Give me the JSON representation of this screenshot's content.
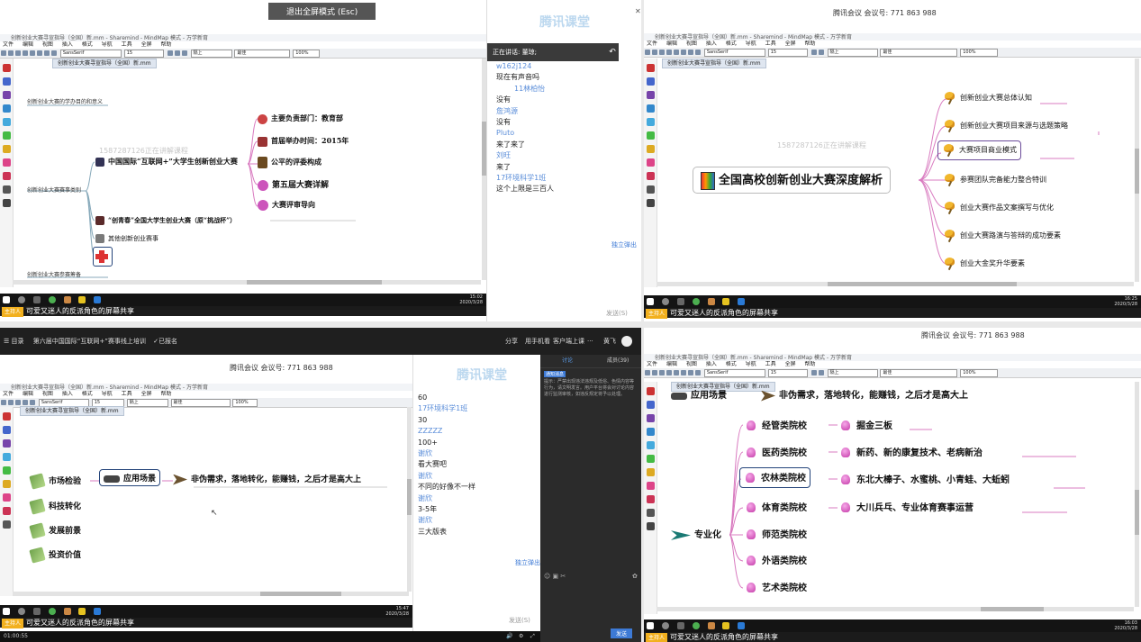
{
  "colors": {
    "accent_blue": "#3d7ad6",
    "chat_name": "#5a8dd9",
    "selection_border": "#24447a",
    "host_badge": "#f2b01e",
    "taskbar": "#141414",
    "link_curve": "#d97bc0"
  },
  "q1": {
    "exit_fullscreen": "退出全屏模式 (Esc)",
    "window_title": "创新创业大赛寻宣指导（全国）新.mm - Sharemind - MindMap 模式 - 万学新育",
    "menu": [
      "文件",
      "编辑",
      "视图",
      "插入",
      "格式",
      "导航",
      "工具",
      "全屏",
      "帮助"
    ],
    "font_select": "SansSerif",
    "size_select": "15",
    "style_select": "隔上",
    "style2_select": "最佳",
    "zoom_select": "100%",
    "doc_tab": "创新创业大赛寻宣指导（全国）新.mm",
    "left_nodes": [
      "创新创业大赛的学办目的和意义",
      "创新创业大赛赛事类别",
      "创新创业大赛参赛筹备"
    ],
    "main_node": "中国国际“互联网+”大学生创新创业大赛",
    "child_nodes": [
      "主要负责部门：教育部",
      "首届举办时间：2015年",
      "公平的评委构成",
      "第五届大赛详解",
      "大赛评审导向"
    ],
    "node_qcz": "“创青春”全国大学生创业大赛（原“挑战杯”）",
    "node_other": "其他创新创业赛事",
    "watermark": "1587287126正在讲解课程",
    "taskbar_time": "15:02",
    "taskbar_date": "2020/3/28",
    "host_label": "主持人",
    "share_text": "可爱又迷人的反派角色的屏幕共享",
    "logo": "腾讯课堂",
    "speaking_label": "正在讲话: 董琼;",
    "chat": [
      {
        "name": "11林柏怡",
        "msg": ""
      },
      {
        "name": "w162j124",
        "msg": "现在有声音吗"
      },
      {
        "name": "11林柏怡",
        "msg": "没有"
      },
      {
        "name": "詹鸿源",
        "msg": "没有"
      },
      {
        "name": "Pluto",
        "msg": "来了来了"
      },
      {
        "name": "刘旺",
        "msg": "来了"
      },
      {
        "name": "17环境科学1班",
        "msg": "这个上限是三百人"
      }
    ],
    "popout": "独立弹出",
    "send": "发送(S)"
  },
  "q2": {
    "meeting_id": "腾讯会议 会议号: 771 863 988",
    "window_title": "创新创业大赛寻宣指导（全国）新.mm - Sharemind - MindMap 模式 - 万学新育",
    "doc_tab": "创新创业大赛寻宣指导（全国）新.mm",
    "root": "全国高校创新创业大赛深度解析",
    "branches": [
      "创新创业大赛总体认知",
      "创新创业大赛项目来源与选题策略",
      "大赛项目商业模式",
      "参赛团队完备能力整合特训",
      "创业大赛作品文案撰写与优化",
      "创业大赛路演与答辩的成功要素",
      "创业大金奖升华要素"
    ],
    "watermark": "1587287126正在讲解课程",
    "taskbar_time": "16:25",
    "taskbar_date": "2020/3/28",
    "host_label": "主持人",
    "share_text": "可爱又迷人的反派角色的屏幕共享"
  },
  "q3": {
    "toc": "目录",
    "course_title": "第六届中国国际“互联网+”赛事线上培训",
    "signed_up": "已报名",
    "share": "分享",
    "phone_watch": "用手机看",
    "client_class": "客户端上课",
    "more": "···",
    "user": "黄飞",
    "meeting_id": "腾讯会议 会议号: 771 863 988",
    "nodes_left": [
      "市场检验",
      "科技转化",
      "发展前景",
      "投资价值"
    ],
    "node_selected": "应用场景",
    "node_right": "非伪需求，落地转化，能赚钱，之后才是高大上",
    "chat": [
      {
        "name": "17环境科学1班",
        "msg": "60"
      },
      {
        "name": "17环境科学1班",
        "msg": "30"
      },
      {
        "name": "ZZZZZ",
        "msg": "100+"
      },
      {
        "name": "谢欣",
        "msg": "看大赛吧"
      },
      {
        "name": "谢欣",
        "msg": "不同的好像不一样"
      },
      {
        "name": "谢欣",
        "msg": "3-5年"
      },
      {
        "name": "谢欣",
        "msg": "三大版表"
      }
    ],
    "popout": "独立弹出",
    "send": "发送(S)",
    "logo": "腾讯课堂",
    "tabs": [
      "讨论",
      "成员(39)"
    ],
    "notice_badge": "通知消息",
    "notice_text": "提示：严禁出现违法违规及低俗、色情内容等行为，请文明发言。用户平台将会对讨论内容进行监测审核，如违反规定将予以处理。",
    "send_button": "发送",
    "play_time": "01:00:55",
    "taskbar_time": "15:47",
    "taskbar_date": "2020/3/28",
    "host_label": "主持人",
    "share_text": "可爱又迷人的反派角色的屏幕共享"
  },
  "q4": {
    "meeting_id": "腾讯会议 会议号: 771 863 988",
    "window_title": "创新创业大赛寻宣指导（全国）新.mm - Sharemind - MindMap 模式 - 万学新育",
    "doc_tab": "创新创业大赛寻宣指导（全国）新.mm",
    "top_cut": "应用场景",
    "top_cut_right": "非伪需求，落地转化，能赚钱，之后才是高大上",
    "root": "专业化",
    "branches": [
      {
        "label": "经管类院校",
        "detail": "掘金三板"
      },
      {
        "label": "医药类院校",
        "detail": "新药、新的康复技术、老病新治"
      },
      {
        "label": "农林类院校",
        "detail": "东北大榛子、水蜜桃、小青蛙、大蚯蚓"
      },
      {
        "label": "体育类院校",
        "detail": "大川兵乓、专业体育赛事运营"
      },
      {
        "label": "师范类院校",
        "detail": ""
      },
      {
        "label": "外语类院校",
        "detail": ""
      },
      {
        "label": "艺术类院校",
        "detail": ""
      }
    ],
    "taskbar_time": "16:03",
    "taskbar_date": "2020/3/28",
    "host_label": "主持人",
    "share_text": "可爱又迷人的反派角色的屏幕共享"
  }
}
